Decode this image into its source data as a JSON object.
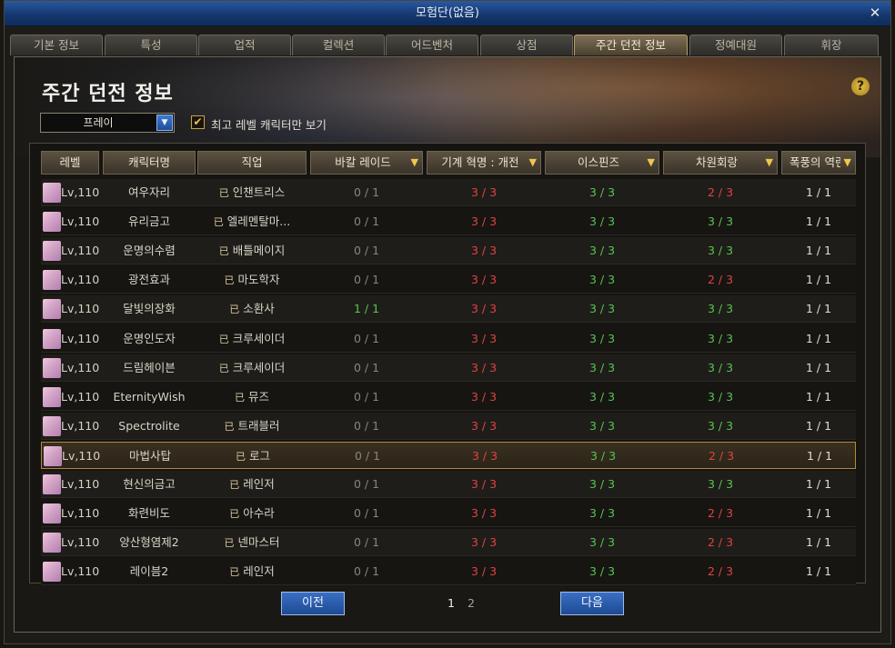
{
  "window": {
    "title": "모험단(없음)"
  },
  "tabs": [
    "기본 정보",
    "특성",
    "업적",
    "컬렉션",
    "어드벤처",
    "상점",
    "주간 던전 정보",
    "정예대원",
    "휘장"
  ],
  "active_tab": 6,
  "page": {
    "title": "주간 던전 정보",
    "help": "?",
    "dropdown_value": "프레이",
    "checkbox_mark": "✔",
    "checkbox_label": "최고 레벨 캐릭터만 보기"
  },
  "table": {
    "headers": [
      "레벨",
      "캐릭터명",
      "직업",
      "바칼 레이드",
      "기계 혁명 : 개전",
      "이스핀즈",
      "차원회랑",
      "폭풍의 역린(주간)"
    ],
    "rows": [
      {
        "level": "Lv,110",
        "name": "여우자리",
        "job": "인챈트리스",
        "d1": "0 / 1",
        "d2": "3 / 3",
        "d3": "3 / 3",
        "d4": "2 / 3",
        "d5": "1 / 1",
        "c1": "gray",
        "c4": "red"
      },
      {
        "level": "Lv,110",
        "name": "유리금고",
        "job": "엘레멘탈마...",
        "d1": "0 / 1",
        "d2": "3 / 3",
        "d3": "3 / 3",
        "d4": "3 / 3",
        "d5": "1 / 1",
        "c1": "gray",
        "c4": "green"
      },
      {
        "level": "Lv,110",
        "name": "운명의수렴",
        "job": "배틀메이지",
        "d1": "0 / 1",
        "d2": "3 / 3",
        "d3": "3 / 3",
        "d4": "3 / 3",
        "d5": "1 / 1",
        "c1": "gray",
        "c4": "green"
      },
      {
        "level": "Lv,110",
        "name": "광전효과",
        "job": "마도학자",
        "d1": "0 / 1",
        "d2": "3 / 3",
        "d3": "3 / 3",
        "d4": "2 / 3",
        "d5": "1 / 1",
        "c1": "gray",
        "c4": "red"
      },
      {
        "level": "Lv,110",
        "name": "달빛의장화",
        "job": "소환사",
        "d1": "1 / 1",
        "d2": "3 / 3",
        "d3": "3 / 3",
        "d4": "3 / 3",
        "d5": "1 / 1",
        "c1": "green",
        "c4": "green"
      },
      {
        "level": "Lv,110",
        "name": "운명인도자",
        "job": "크루세이더",
        "d1": "0 / 1",
        "d2": "3 / 3",
        "d3": "3 / 3",
        "d4": "3 / 3",
        "d5": "1 / 1",
        "c1": "gray",
        "c4": "green"
      },
      {
        "level": "Lv,110",
        "name": "드림헤이븐",
        "job": "크루세이더",
        "d1": "0 / 1",
        "d2": "3 / 3",
        "d3": "3 / 3",
        "d4": "3 / 3",
        "d5": "1 / 1",
        "c1": "gray",
        "c4": "green"
      },
      {
        "level": "Lv,110",
        "name": "EternityWish",
        "job": "뮤즈",
        "d1": "0 / 1",
        "d2": "3 / 3",
        "d3": "3 / 3",
        "d4": "3 / 3",
        "d5": "1 / 1",
        "c1": "gray",
        "c4": "green"
      },
      {
        "level": "Lv,110",
        "name": "Spectrolite",
        "job": "트래블러",
        "d1": "0 / 1",
        "d2": "3 / 3",
        "d3": "3 / 3",
        "d4": "3 / 3",
        "d5": "1 / 1",
        "c1": "gray",
        "c4": "green"
      },
      {
        "level": "Lv,110",
        "name": "마법사탑",
        "job": "로그",
        "d1": "0 / 1",
        "d2": "3 / 3",
        "d3": "3 / 3",
        "d4": "2 / 3",
        "d5": "1 / 1",
        "c1": "gray",
        "c4": "red"
      },
      {
        "level": "Lv,110",
        "name": "현신의금고",
        "job": "레인저",
        "d1": "0 / 1",
        "d2": "3 / 3",
        "d3": "3 / 3",
        "d4": "3 / 3",
        "d5": "1 / 1",
        "c1": "gray",
        "c4": "green"
      },
      {
        "level": "Lv,110",
        "name": "화련비도",
        "job": "아수라",
        "d1": "0 / 1",
        "d2": "3 / 3",
        "d3": "3 / 3",
        "d4": "2 / 3",
        "d5": "1 / 1",
        "c1": "gray",
        "c4": "red"
      },
      {
        "level": "Lv,110",
        "name": "양산형염제2",
        "job": "넨마스터",
        "d1": "0 / 1",
        "d2": "3 / 3",
        "d3": "3 / 3",
        "d4": "2 / 3",
        "d5": "1 / 1",
        "c1": "gray",
        "c4": "red"
      },
      {
        "level": "Lv,110",
        "name": "레이븜2",
        "job": "레인저",
        "d1": "0 / 1",
        "d2": "3 / 3",
        "d3": "3 / 3",
        "d4": "2 / 3",
        "d5": "1 / 1",
        "c1": "gray",
        "c4": "red"
      }
    ],
    "selected_row": 9
  },
  "pager": {
    "prev": "이전",
    "next": "다음",
    "pages": [
      "1",
      "2"
    ],
    "current": "1"
  },
  "colors": {
    "red": "#e24242",
    "green": "#55c552",
    "gray": "#8a857a",
    "accent_gold": "#f0c74c",
    "button_blue": "#2a5cb0"
  }
}
